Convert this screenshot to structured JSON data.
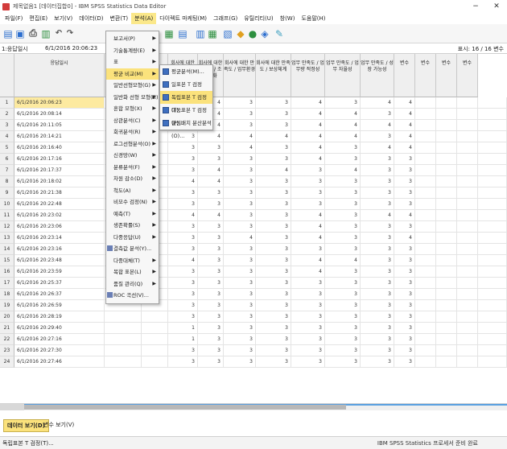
{
  "window": {
    "title": "제목없음1 [데이터집합0] - IBM SPSS Statistics Data Editor",
    "minimize": "−",
    "close": "✕"
  },
  "menubar": [
    "파일(F)",
    "편집(E)",
    "보기(V)",
    "데이터(D)",
    "변환(T)",
    "분석(A)",
    "다이렉트 마케팅(M)",
    "그래프(G)",
    "유틸리티(U)",
    "창(W)",
    "도움말(H)"
  ],
  "cellbar": {
    "ref": "1:응답일시",
    "value": "6/1/2016 20:06:23",
    "visible": "표시: 16 / 16 변수"
  },
  "columns": [
    {
      "label": "응답일시"
    },
    {
      "label": ""
    },
    {
      "label": ""
    },
    {
      "label": "회사에 대한 만족도 / 관리자 리더십"
    },
    {
      "label": "회사에 대한 만족도 / 조직문화"
    },
    {
      "label": "회사에 대한 만족도 / 업무환경"
    },
    {
      "label": "회사에 대한 만족도 / 보상체계"
    },
    {
      "label": "업무 만족도 / 업무량 적정성"
    },
    {
      "label": "업무 만족도 / 업무 자율성"
    },
    {
      "label": "업무 만족도 / 성장 가능성"
    },
    {
      "label": "변수"
    },
    {
      "label": "변수"
    },
    {
      "label": "변수"
    },
    {
      "label": "변수"
    }
  ],
  "rows": [
    {
      "n": "1",
      "date": "6/1/2016 20:06:23",
      "v": [
        "4",
        "4",
        "3",
        "3",
        "4",
        "3",
        "4",
        "4"
      ]
    },
    {
      "n": "2",
      "date": "6/1/2016 20:08:14",
      "v": [
        "4",
        "4",
        "3",
        "3",
        "4",
        "4",
        "3",
        "4"
      ]
    },
    {
      "n": "3",
      "date": "6/1/2016 20:11:05",
      "v": [
        "4",
        "4",
        "3",
        "3",
        "4",
        "4",
        "4",
        "4"
      ]
    },
    {
      "n": "4",
      "date": "6/1/2016 20:14:21",
      "v": [
        "3",
        "4",
        "4",
        "4",
        "4",
        "4",
        "3",
        "4"
      ]
    },
    {
      "n": "5",
      "date": "6/1/2016 20:16:40",
      "v": [
        "3",
        "3",
        "4",
        "3",
        "4",
        "3",
        "4",
        "4"
      ]
    },
    {
      "n": "6",
      "date": "6/1/2016 20:17:16",
      "v": [
        "3",
        "3",
        "3",
        "3",
        "4",
        "3",
        "3",
        "3"
      ]
    },
    {
      "n": "7",
      "date": "6/1/2016 20:17:37",
      "v": [
        "3",
        "4",
        "3",
        "4",
        "3",
        "4",
        "3",
        "3"
      ]
    },
    {
      "n": "8",
      "date": "6/1/2016 20:18:02",
      "v": [
        "4",
        "4",
        "3",
        "3",
        "3",
        "3",
        "3",
        "3"
      ]
    },
    {
      "n": "9",
      "date": "6/1/2016 20:21:38",
      "v": [
        "3",
        "3",
        "3",
        "3",
        "3",
        "3",
        "3",
        "3"
      ]
    },
    {
      "n": "10",
      "date": "6/1/2016 20:22:48",
      "v": [
        "3",
        "3",
        "3",
        "3",
        "3",
        "3",
        "3",
        "3"
      ]
    },
    {
      "n": "11",
      "date": "6/1/2016 20:23:02",
      "v": [
        "4",
        "4",
        "3",
        "3",
        "4",
        "3",
        "4",
        "4"
      ]
    },
    {
      "n": "12",
      "date": "6/1/2016 20:23:06",
      "v": [
        "3",
        "3",
        "3",
        "3",
        "4",
        "3",
        "3",
        "3"
      ]
    },
    {
      "n": "13",
      "date": "6/1/2016 20:23:14",
      "v": [
        "3",
        "3",
        "4",
        "3",
        "4",
        "3",
        "3",
        "4"
      ]
    },
    {
      "n": "14",
      "date": "6/1/2016 20:23:16",
      "v": [
        "3",
        "3",
        "3",
        "3",
        "3",
        "3",
        "3",
        "3"
      ]
    },
    {
      "n": "15",
      "date": "6/1/2016 20:23:48",
      "v": [
        "4",
        "3",
        "3",
        "3",
        "4",
        "4",
        "3",
        "3"
      ]
    },
    {
      "n": "16",
      "date": "6/1/2016 20:23:59",
      "v": [
        "3",
        "3",
        "3",
        "3",
        "4",
        "3",
        "3",
        "3"
      ]
    },
    {
      "n": "17",
      "date": "6/1/2016 20:25:37",
      "v": [
        "3",
        "3",
        "3",
        "3",
        "3",
        "3",
        "3",
        "3"
      ]
    },
    {
      "n": "18",
      "date": "6/1/2016 20:26:37",
      "v": [
        "3",
        "3",
        "3",
        "3",
        "3",
        "3",
        "3",
        "3"
      ]
    },
    {
      "n": "19",
      "date": "6/1/2016 20:26:59",
      "v": [
        "3",
        "3",
        "3",
        "3",
        "3",
        "3",
        "3",
        "3"
      ]
    },
    {
      "n": "20",
      "date": "6/1/2016 20:28:19",
      "v": [
        "3",
        "3",
        "3",
        "3",
        "3",
        "3",
        "3",
        "3"
      ]
    },
    {
      "n": "21",
      "date": "6/1/2016 20:29:40",
      "v": [
        "1",
        "3",
        "3",
        "3",
        "3",
        "3",
        "3",
        "3"
      ]
    },
    {
      "n": "22",
      "date": "6/1/2016 20:27:16",
      "v": [
        "1",
        "3",
        "3",
        "3",
        "3",
        "3",
        "3",
        "3"
      ]
    },
    {
      "n": "23",
      "date": "6/1/2016 20:27:30",
      "v": [
        "3",
        "3",
        "3",
        "3",
        "3",
        "3",
        "3",
        "3"
      ]
    },
    {
      "n": "24",
      "date": "6/1/2016 20:27:46",
      "v": [
        "3",
        "3",
        "3",
        "3",
        "3",
        "3",
        "3",
        "3"
      ]
    }
  ],
  "row_values_partial": [
    [
      "",
      "",
      "4",
      "3",
      "3",
      "4",
      "4",
      "4",
      "4",
      "4"
    ],
    [
      "",
      "",
      "3",
      "3",
      "3",
      "4",
      "4",
      "3",
      "4",
      "4"
    ]
  ],
  "analyze_menu": [
    {
      "label": "보고서(P)",
      "arrow": "▶"
    },
    {
      "label": "기술통계량(E)",
      "arrow": "▶"
    },
    {
      "label": "표",
      "arrow": "▶"
    },
    {
      "label": "평균 비교(M)",
      "arrow": "▶"
    },
    {
      "label": "일반선형모형(G)",
      "arrow": "▶"
    },
    {
      "label": "일반화 선형 모형(Z)",
      "arrow": "▶"
    },
    {
      "label": "혼합 모형(X)",
      "arrow": "▶"
    },
    {
      "label": "상관분석(C)",
      "arrow": "▶"
    },
    {
      "label": "회귀분석(R)",
      "arrow": "▶"
    },
    {
      "label": "로그선형분석(O)",
      "arrow": "▶"
    },
    {
      "label": "신경망(W)",
      "arrow": "▶"
    },
    {
      "label": "분류분석(F)",
      "arrow": "▶"
    },
    {
      "label": "차원 감소(D)",
      "arrow": "▶"
    },
    {
      "label": "척도(A)",
      "arrow": "▶"
    },
    {
      "label": "비모수 검정(N)",
      "arrow": "▶"
    },
    {
      "label": "예측(T)",
      "arrow": "▶"
    },
    {
      "label": "생존확률(S)",
      "arrow": "▶"
    },
    {
      "label": "다중응답(U)",
      "arrow": "▶"
    },
    {
      "label": "결측값 분석(Y)...",
      "arrow": ""
    },
    {
      "label": "다중대체(T)",
      "arrow": "▶"
    },
    {
      "label": "복합 표본(L)",
      "arrow": "▶"
    },
    {
      "label": "품질 관리(Q)",
      "arrow": "▶"
    },
    {
      "label": "ROC 곡선(V)...",
      "arrow": ""
    }
  ],
  "means_submenu": [
    {
      "label": "평균분석(M)..."
    },
    {
      "label": "일표본 T 검정(S)..."
    },
    {
      "label": "독립표본 T 검정(T)..."
    },
    {
      "label": "대응표본 T 검정(P)..."
    },
    {
      "label": "일원배치 분산분석(O)..."
    }
  ],
  "tabs": {
    "data_view": "데이터 보기(D)",
    "variable_view": "변수 보기(V)"
  },
  "status": {
    "left": "독립표본 T 검정(T)...",
    "right": "IBM SPSS Statistics 프로세서 준비 완료"
  }
}
